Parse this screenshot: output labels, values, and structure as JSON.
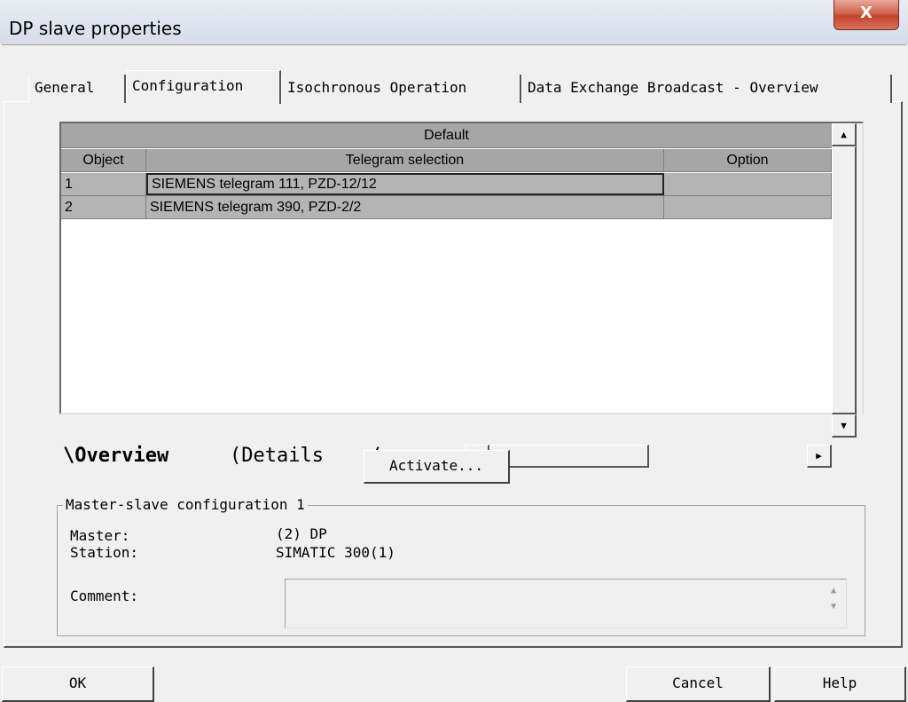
{
  "window": {
    "title": "DP slave properties",
    "close_glyph": "X"
  },
  "tabs": [
    {
      "label": "General"
    },
    {
      "label": "Configuration"
    },
    {
      "label": "Isochronous Operation"
    },
    {
      "label": "Data Exchange Broadcast - Overview"
    }
  ],
  "grid": {
    "group_header": "Default",
    "columns": [
      "Object",
      "Telegram selection",
      "Option"
    ],
    "rows": [
      {
        "object": "1",
        "telegram": "SIEMENS telegram 111, PZD-12/12",
        "option": ""
      },
      {
        "object": "2",
        "telegram": "SIEMENS telegram 390, PZD-2/2",
        "option": ""
      }
    ],
    "sheet_tabs": {
      "overview": "\\Overview",
      "details": "Details"
    }
  },
  "activate_button": "Activate...",
  "master_slave": {
    "title": "Master-slave configuration 1",
    "master_label": "Master:",
    "master_value": "(2) DP",
    "station_label": "Station:",
    "station_value": "SIMATIC 300(1)",
    "comment_label": "Comment:",
    "comment_value": ""
  },
  "buttons": {
    "ok": "OK",
    "cancel": "Cancel",
    "help": "Help"
  },
  "icons": {
    "scroll_up": "scroll-up-arrow-icon",
    "scroll_down": "scroll-down-arrow-icon",
    "scroll_left": "scroll-left-arrow-icon",
    "scroll_right": "scroll-right-arrow-icon"
  }
}
